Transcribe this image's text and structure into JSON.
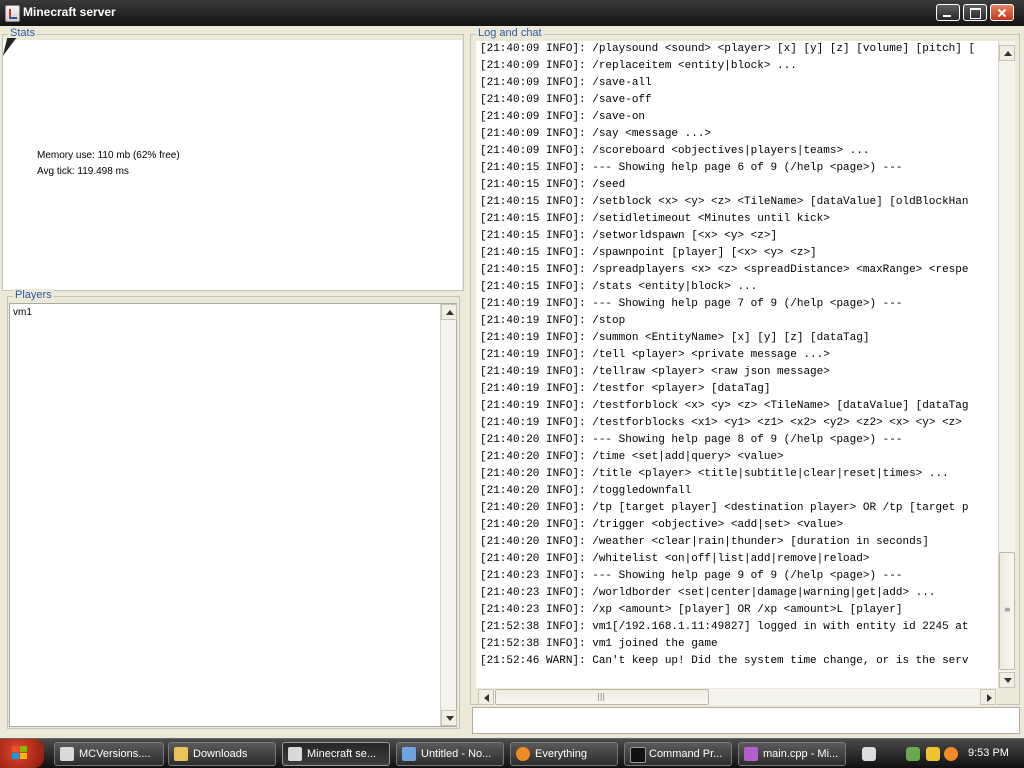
{
  "window": {
    "title": "Minecraft server"
  },
  "stats": {
    "group_title": "Stats",
    "memory_use": "Memory use: 110 mb (62% free)",
    "avg_tick": "Avg tick: 119.498 ms"
  },
  "players": {
    "group_title": "Players",
    "list": [
      "vm1"
    ]
  },
  "log": {
    "group_title": "Log and chat",
    "lines": [
      "[21:40:09 INFO]: /playsound <sound> <player> [x] [y] [z] [volume] [pitch] [",
      "[21:40:09 INFO]: /replaceitem <entity|block> ...",
      "[21:40:09 INFO]: /save-all",
      "[21:40:09 INFO]: /save-off",
      "[21:40:09 INFO]: /save-on",
      "[21:40:09 INFO]: /say <message ...>",
      "[21:40:09 INFO]: /scoreboard <objectives|players|teams> ...",
      "[21:40:15 INFO]: --- Showing help page 6 of 9 (/help <page>) ---",
      "[21:40:15 INFO]: /seed",
      "[21:40:15 INFO]: /setblock <x> <y> <z> <TileName> [dataValue] [oldBlockHan",
      "[21:40:15 INFO]: /setidletimeout <Minutes until kick>",
      "[21:40:15 INFO]: /setworldspawn [<x> <y> <z>]",
      "[21:40:15 INFO]: /spawnpoint [player] [<x> <y> <z>]",
      "[21:40:15 INFO]: /spreadplayers <x> <z> <spreadDistance> <maxRange> <respe",
      "[21:40:15 INFO]: /stats <entity|block> ...",
      "[21:40:19 INFO]: --- Showing help page 7 of 9 (/help <page>) ---",
      "[21:40:19 INFO]: /stop",
      "[21:40:19 INFO]: /summon <EntityName> [x] [y] [z] [dataTag]",
      "[21:40:19 INFO]: /tell <player> <private message ...>",
      "[21:40:19 INFO]: /tellraw <player> <raw json message>",
      "[21:40:19 INFO]: /testfor <player> [dataTag]",
      "[21:40:19 INFO]: /testforblock <x> <y> <z> <TileName> [dataValue] [dataTag",
      "[21:40:19 INFO]: /testforblocks <x1> <y1> <z1> <x2> <y2> <z2> <x> <y> <z>",
      "[21:40:20 INFO]: --- Showing help page 8 of 9 (/help <page>) ---",
      "[21:40:20 INFO]: /time <set|add|query> <value>",
      "[21:40:20 INFO]: /title <player> <title|subtitle|clear|reset|times> ...",
      "[21:40:20 INFO]: /toggledownfall",
      "[21:40:20 INFO]: /tp [target player] <destination player> OR /tp [target p",
      "[21:40:20 INFO]: /trigger <objective> <add|set> <value>",
      "[21:40:20 INFO]: /weather <clear|rain|thunder> [duration in seconds]",
      "[21:40:20 INFO]: /whitelist <on|off|list|add|remove|reload>",
      "[21:40:23 INFO]: --- Showing help page 9 of 9 (/help <page>) ---",
      "[21:40:23 INFO]: /worldborder <set|center|damage|warning|get|add> ...",
      "[21:40:23 INFO]: /xp <amount> [player] OR /xp <amount>L [player]",
      "[21:52:38 INFO]: vm1[/192.168.1.11:49827] logged in with entity id 2245 at",
      "[21:52:38 INFO]: vm1 joined the game",
      "[21:52:46 WARN]: Can't keep up! Did the system time change, or is the serv"
    ],
    "input_value": ""
  },
  "taskbar": {
    "items": [
      {
        "label": "MCVersions....",
        "icon": "java-icon"
      },
      {
        "label": "Downloads",
        "icon": "folder-icon"
      },
      {
        "label": "Minecraft se...",
        "icon": "java-icon"
      },
      {
        "label": "Untitled - No...",
        "icon": "notepad-icon"
      },
      {
        "label": "Everything",
        "icon": "search-icon"
      },
      {
        "label": "Command Pr...",
        "icon": "cmd-icon"
      },
      {
        "label": "main.cpp - Mi...",
        "icon": "visual-studio-icon"
      }
    ],
    "clock": "9:53 PM"
  },
  "colors": {
    "group_title": "#2c5aa5",
    "title_bar": "#1f1f1f",
    "taskbar": "#1a1a1a",
    "start_button": "#c8321c"
  }
}
